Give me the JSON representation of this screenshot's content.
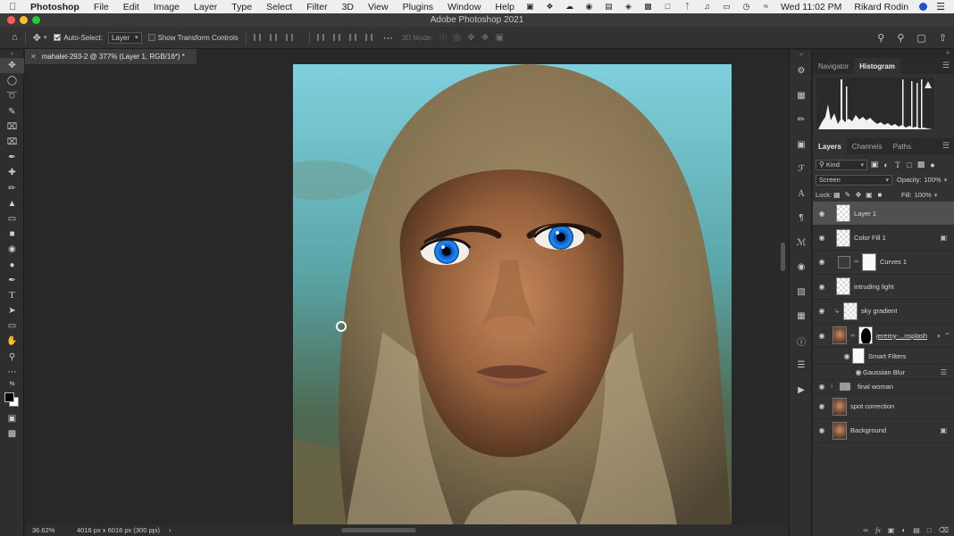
{
  "menubar": {
    "app": "Photoshop",
    "items": [
      "File",
      "Edit",
      "Image",
      "Layer",
      "Type",
      "Select",
      "Filter",
      "3D",
      "View",
      "Plugins",
      "Window",
      "Help"
    ],
    "clock": "Wed 11:02 PM",
    "user": "Rikard Rodin"
  },
  "window": {
    "title": "Adobe Photoshop 2021"
  },
  "options": {
    "auto_select_label": "Auto-Select:",
    "auto_select_target": "Layer",
    "transform_label": "Show Transform Controls",
    "mode_3d_label": "3D Mode:"
  },
  "document": {
    "tab_title": "mahalet-293-2 @ 377% (Layer 1, RGB/16*) *",
    "zoom": "36.62%",
    "info": "4016 px x 6016 px (300 ppi)"
  },
  "navigator_tabs": [
    "Navigator",
    "Histogram"
  ],
  "layers_panel": {
    "tabs": [
      "Layers",
      "Channels",
      "Paths"
    ],
    "kind_label": "Kind",
    "blend_mode": "Screen",
    "opacity_label": "Opacity:",
    "opacity_value": "100%",
    "lock_label": "Lock:",
    "fill_label": "Fill:",
    "fill_value": "100%",
    "layers": [
      {
        "name": "Layer 1"
      },
      {
        "name": "Color Fill 1"
      },
      {
        "name": "Curves 1"
      },
      {
        "name": "intruding light"
      },
      {
        "name": "sky gradient"
      },
      {
        "name": "jeremy-...nsplash"
      },
      {
        "name": "Smart Filters"
      },
      {
        "name": "Gaussian Blur"
      },
      {
        "name": "final woman"
      },
      {
        "name": "spot correction"
      },
      {
        "name": "Background"
      }
    ]
  },
  "colors": {
    "accent": "#1473e6",
    "eye_blue": "#1e8cff",
    "sky": "#7fd0de"
  }
}
